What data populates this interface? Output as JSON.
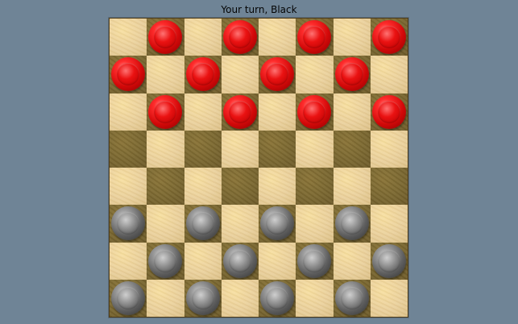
{
  "status": {
    "turn_text": "Your turn, Black"
  },
  "board": {
    "rows": 8,
    "cols": 8,
    "squares": [
      [
        "light",
        "dark",
        "light",
        "dark",
        "light",
        "dark",
        "light",
        "dark"
      ],
      [
        "dark",
        "light",
        "dark",
        "light",
        "dark",
        "light",
        "dark",
        "light"
      ],
      [
        "light",
        "dark",
        "light",
        "dark",
        "light",
        "dark",
        "light",
        "dark"
      ],
      [
        "dark",
        "light",
        "dark",
        "light",
        "dark",
        "light",
        "dark",
        "light"
      ],
      [
        "light",
        "dark",
        "light",
        "dark",
        "light",
        "dark",
        "light",
        "dark"
      ],
      [
        "dark",
        "light",
        "dark",
        "light",
        "dark",
        "light",
        "dark",
        "light"
      ],
      [
        "light",
        "dark",
        "light",
        "dark",
        "light",
        "dark",
        "light",
        "dark"
      ],
      [
        "dark",
        "light",
        "dark",
        "light",
        "dark",
        "light",
        "dark",
        "light"
      ]
    ],
    "pieces": [
      [
        null,
        "red",
        null,
        "red",
        null,
        "red",
        null,
        "red"
      ],
      [
        "red",
        null,
        "red",
        null,
        "red",
        null,
        "red",
        null
      ],
      [
        null,
        "red",
        null,
        "red",
        null,
        "red",
        null,
        "red"
      ],
      [
        null,
        null,
        null,
        null,
        null,
        null,
        null,
        null
      ],
      [
        null,
        null,
        null,
        null,
        null,
        null,
        null,
        null
      ],
      [
        "black",
        null,
        "black",
        null,
        "black",
        null,
        "black",
        null
      ],
      [
        null,
        "black",
        null,
        "black",
        null,
        "black",
        null,
        "black"
      ],
      [
        "black",
        null,
        "black",
        null,
        "black",
        null,
        "black",
        null
      ]
    ]
  },
  "colors": {
    "background": "#6f8496",
    "status_text": "#050505",
    "light_square": "#ead09c",
    "dark_square": "#7b6831",
    "board_frame": "#4b3b1c",
    "red_piece": "#d20909",
    "black_piece": "#5d5d5d"
  }
}
